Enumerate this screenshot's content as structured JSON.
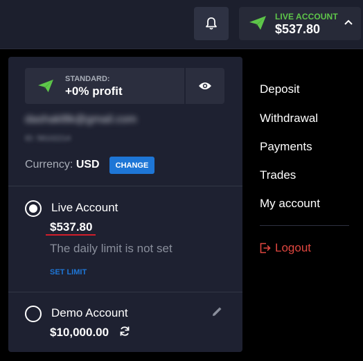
{
  "header": {
    "account_type": "LIVE ACCOUNT",
    "balance": "$537.80",
    "bell_icon": "bell-icon",
    "chevron_icon": "chevron-up-icon"
  },
  "panel": {
    "plan_label": "STANDARD:",
    "plan_value": "+0% profit",
    "email": "dashakl8k@gmail.com",
    "user_id": "ID: 58102214",
    "currency_label": "Currency:",
    "currency_value": "USD",
    "change_label": "CHANGE",
    "live": {
      "title": "Live Account",
      "balance": "$537.80",
      "limit_text": "The daily limit is not set",
      "set_limit": "SET LIMIT"
    },
    "demo": {
      "title": "Demo Account",
      "balance": "$10,000.00"
    }
  },
  "menu": {
    "items": [
      "Deposit",
      "Withdrawal",
      "Payments",
      "Trades",
      "My account"
    ],
    "logout": "Logout"
  },
  "colors": {
    "accent_green": "#5ec64a",
    "accent_blue": "#1e76d6",
    "logout_red": "#e0463f"
  }
}
